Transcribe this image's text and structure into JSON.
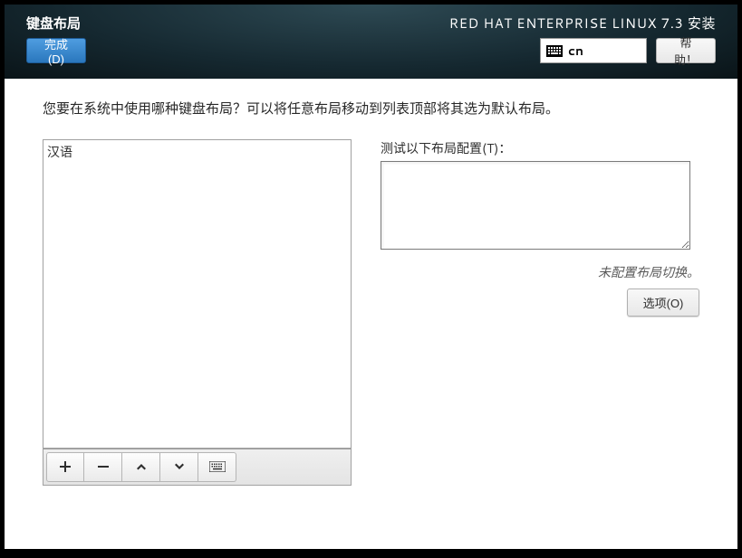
{
  "header": {
    "title": "键盘布局",
    "done_label": "完成(D)",
    "product": "RED HAT ENTERPRISE LINUX 7.3 安装",
    "lang_code": "cn",
    "help_label": "帮助！"
  },
  "main": {
    "prompt": "您要在系统中使用哪种键盘布局？可以将任意布局移动到列表顶部将其选为默认布局。",
    "layouts": [
      "汉语"
    ],
    "test_label": "测试以下布局配置(T)：",
    "switch_status": "未配置布局切换。",
    "options_label": "选项(O)"
  },
  "icons": {
    "add": "plus-icon",
    "remove": "minus-icon",
    "move_up": "chevron-up-icon",
    "move_down": "chevron-down-icon",
    "keyboard_preview": "keyboard-icon"
  }
}
